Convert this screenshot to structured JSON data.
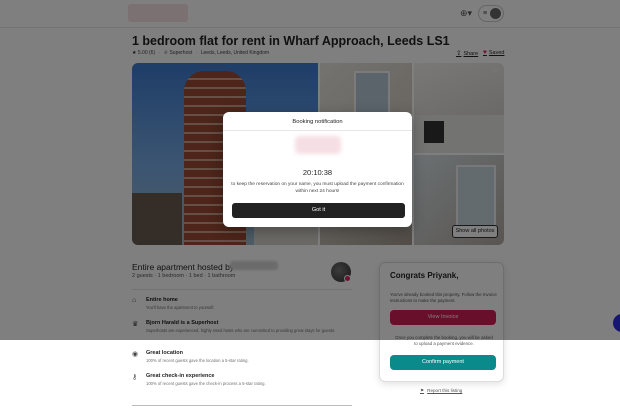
{
  "header": {
    "language_icon": "globe-icon",
    "menu_icon": "hamburger-icon"
  },
  "listing": {
    "title": "1 bedroom flat for rent in Wharf Approach, Leeds LS1",
    "rating": "5.00",
    "reviews": "(6)",
    "superhost": "Superhost",
    "location": "Leeds, Leeds, United Kingdom",
    "share_label": "Share",
    "save_label": "Saved",
    "show_all_photos": "Show all photos"
  },
  "host": {
    "title": "Entire apartment hosted by",
    "summary": "2 guests · 1 bedroom · 1 bed · 1 bathroom"
  },
  "features": [
    {
      "icon": "home-icon",
      "title": "Entire home",
      "desc": "You'll have the apartment to yourself."
    },
    {
      "icon": "medal-icon",
      "title": "Bjorn Harald is a Superhost",
      "desc": "Superhosts are experienced, highly rated hosts who are committed to providing great stays for guests."
    },
    {
      "icon": "location-pin-icon",
      "title": "Great location",
      "desc": "100% of recent guests gave the location a 5-star rating."
    },
    {
      "icon": "key-icon",
      "title": "Great check-in experience",
      "desc": "100% of recent guests gave the check-in process a 5-star rating."
    }
  ],
  "booking_card": {
    "greeting": "Congrats Priyank,",
    "message": "You've already booked this property. Follow the Invoice instructions to make the payment.",
    "view_invoice": "View Invoice",
    "message2": "Once you complete the booking, you will be asked to upload a payment evidence.",
    "confirm_payment": "Confirm payment"
  },
  "report_listing": "Report this listing",
  "modal": {
    "title": "Booking notification",
    "timer": "20:10:38",
    "message": "to keep the reservation on your name, you must upload the payment confirmation within next 24 hours!",
    "button": "Got it"
  },
  "colors": {
    "brand": "#e0245e",
    "view_invoice": "#cf1f57",
    "confirm": "#0a8a8a",
    "chat": "#2b2fe0"
  }
}
